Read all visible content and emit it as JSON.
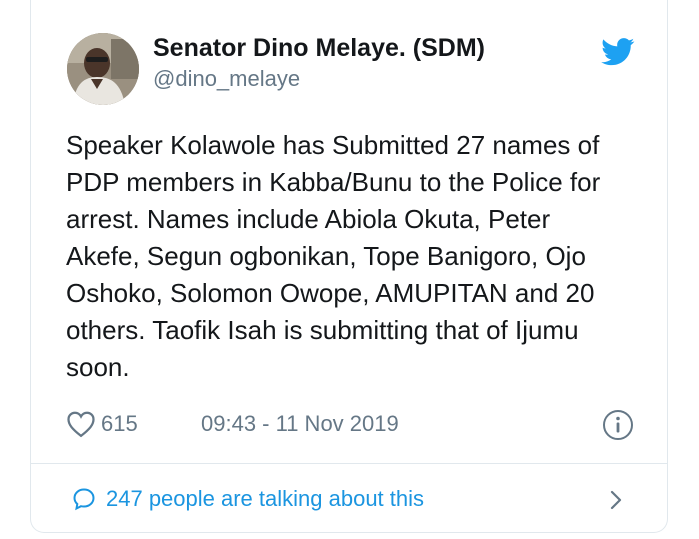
{
  "author": {
    "display_name": "Senator Dino Melaye. (SDM)",
    "handle": "@dino_melaye"
  },
  "icons": {
    "brand": "twitter-bird-icon",
    "like": "heart-icon",
    "info": "info-icon",
    "reply": "speech-bubble-icon",
    "more": "chevron-right-icon"
  },
  "tweet": {
    "lines": [
      "Speaker Kolawole has Submitted 27 names of",
      "PDP members in Kabba/Bunu to the Police for",
      "arrest. Names include Abiola Okuta, Peter",
      "Akefe, Segun ogbonikan, Tope Banigoro, Ojo",
      "Oshoko, Solomon Owope, AMUPITAN and 20",
      "others. Taofik Isah is submitting that of Ijumu",
      "soon."
    ],
    "likes": "615",
    "timestamp": "09:43 - 11 Nov 2019"
  },
  "conversation": {
    "label": "247 people are talking about this"
  },
  "colors": {
    "brand_blue": "#1da1f2",
    "link_blue": "#1b95e0",
    "muted": "#657786",
    "text": "#14171a",
    "border": "#e1e8ed"
  }
}
